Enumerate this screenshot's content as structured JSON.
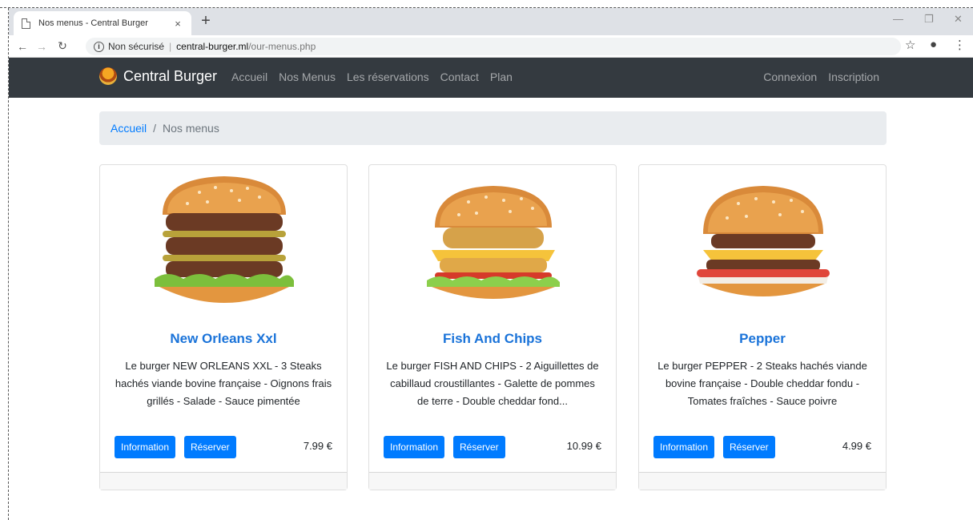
{
  "browser": {
    "tab_title": "Nos menus - Central Burger",
    "tab_close": "×",
    "new_tab": "+",
    "security_label": "Non sécurisé",
    "url_host": "central-burger.ml",
    "url_path": "/our-menus.php"
  },
  "navbar": {
    "brand": "Central Burger",
    "links": [
      "Accueil",
      "Nos Menus",
      "Les réservations",
      "Contact",
      "Plan"
    ],
    "right_links": [
      "Connexion",
      "Inscription"
    ]
  },
  "breadcrumb": {
    "home": "Accueil",
    "separator": "/",
    "current": "Nos menus"
  },
  "menus": [
    {
      "name": "New Orleans Xxl",
      "description": "Le burger NEW ORLEANS XXL - 3 Steaks hachés viande bovine française - Oignons frais grillés - Salade - Sauce pimentée",
      "info_label": "Information",
      "reserve_label": "Réserver",
      "price": "7.99 €"
    },
    {
      "name": "Fish And Chips",
      "description": "Le burger FISH AND CHIPS - 2 Aiguillettes de cabillaud croustillantes - Galette de pommes de terre - Double cheddar fond...",
      "info_label": "Information",
      "reserve_label": "Réserver",
      "price": "10.99 €"
    },
    {
      "name": "Pepper",
      "description": "Le burger PEPPER - 2 Steaks hachés viande bovine française - Double cheddar fondu - Tomates fraîches - Sauce poivre",
      "info_label": "Information",
      "reserve_label": "Réserver",
      "price": "4.99 €"
    }
  ],
  "colors": {
    "navbar_bg": "#343a40",
    "primary": "#007bff",
    "card_title": "#1a73d9"
  }
}
